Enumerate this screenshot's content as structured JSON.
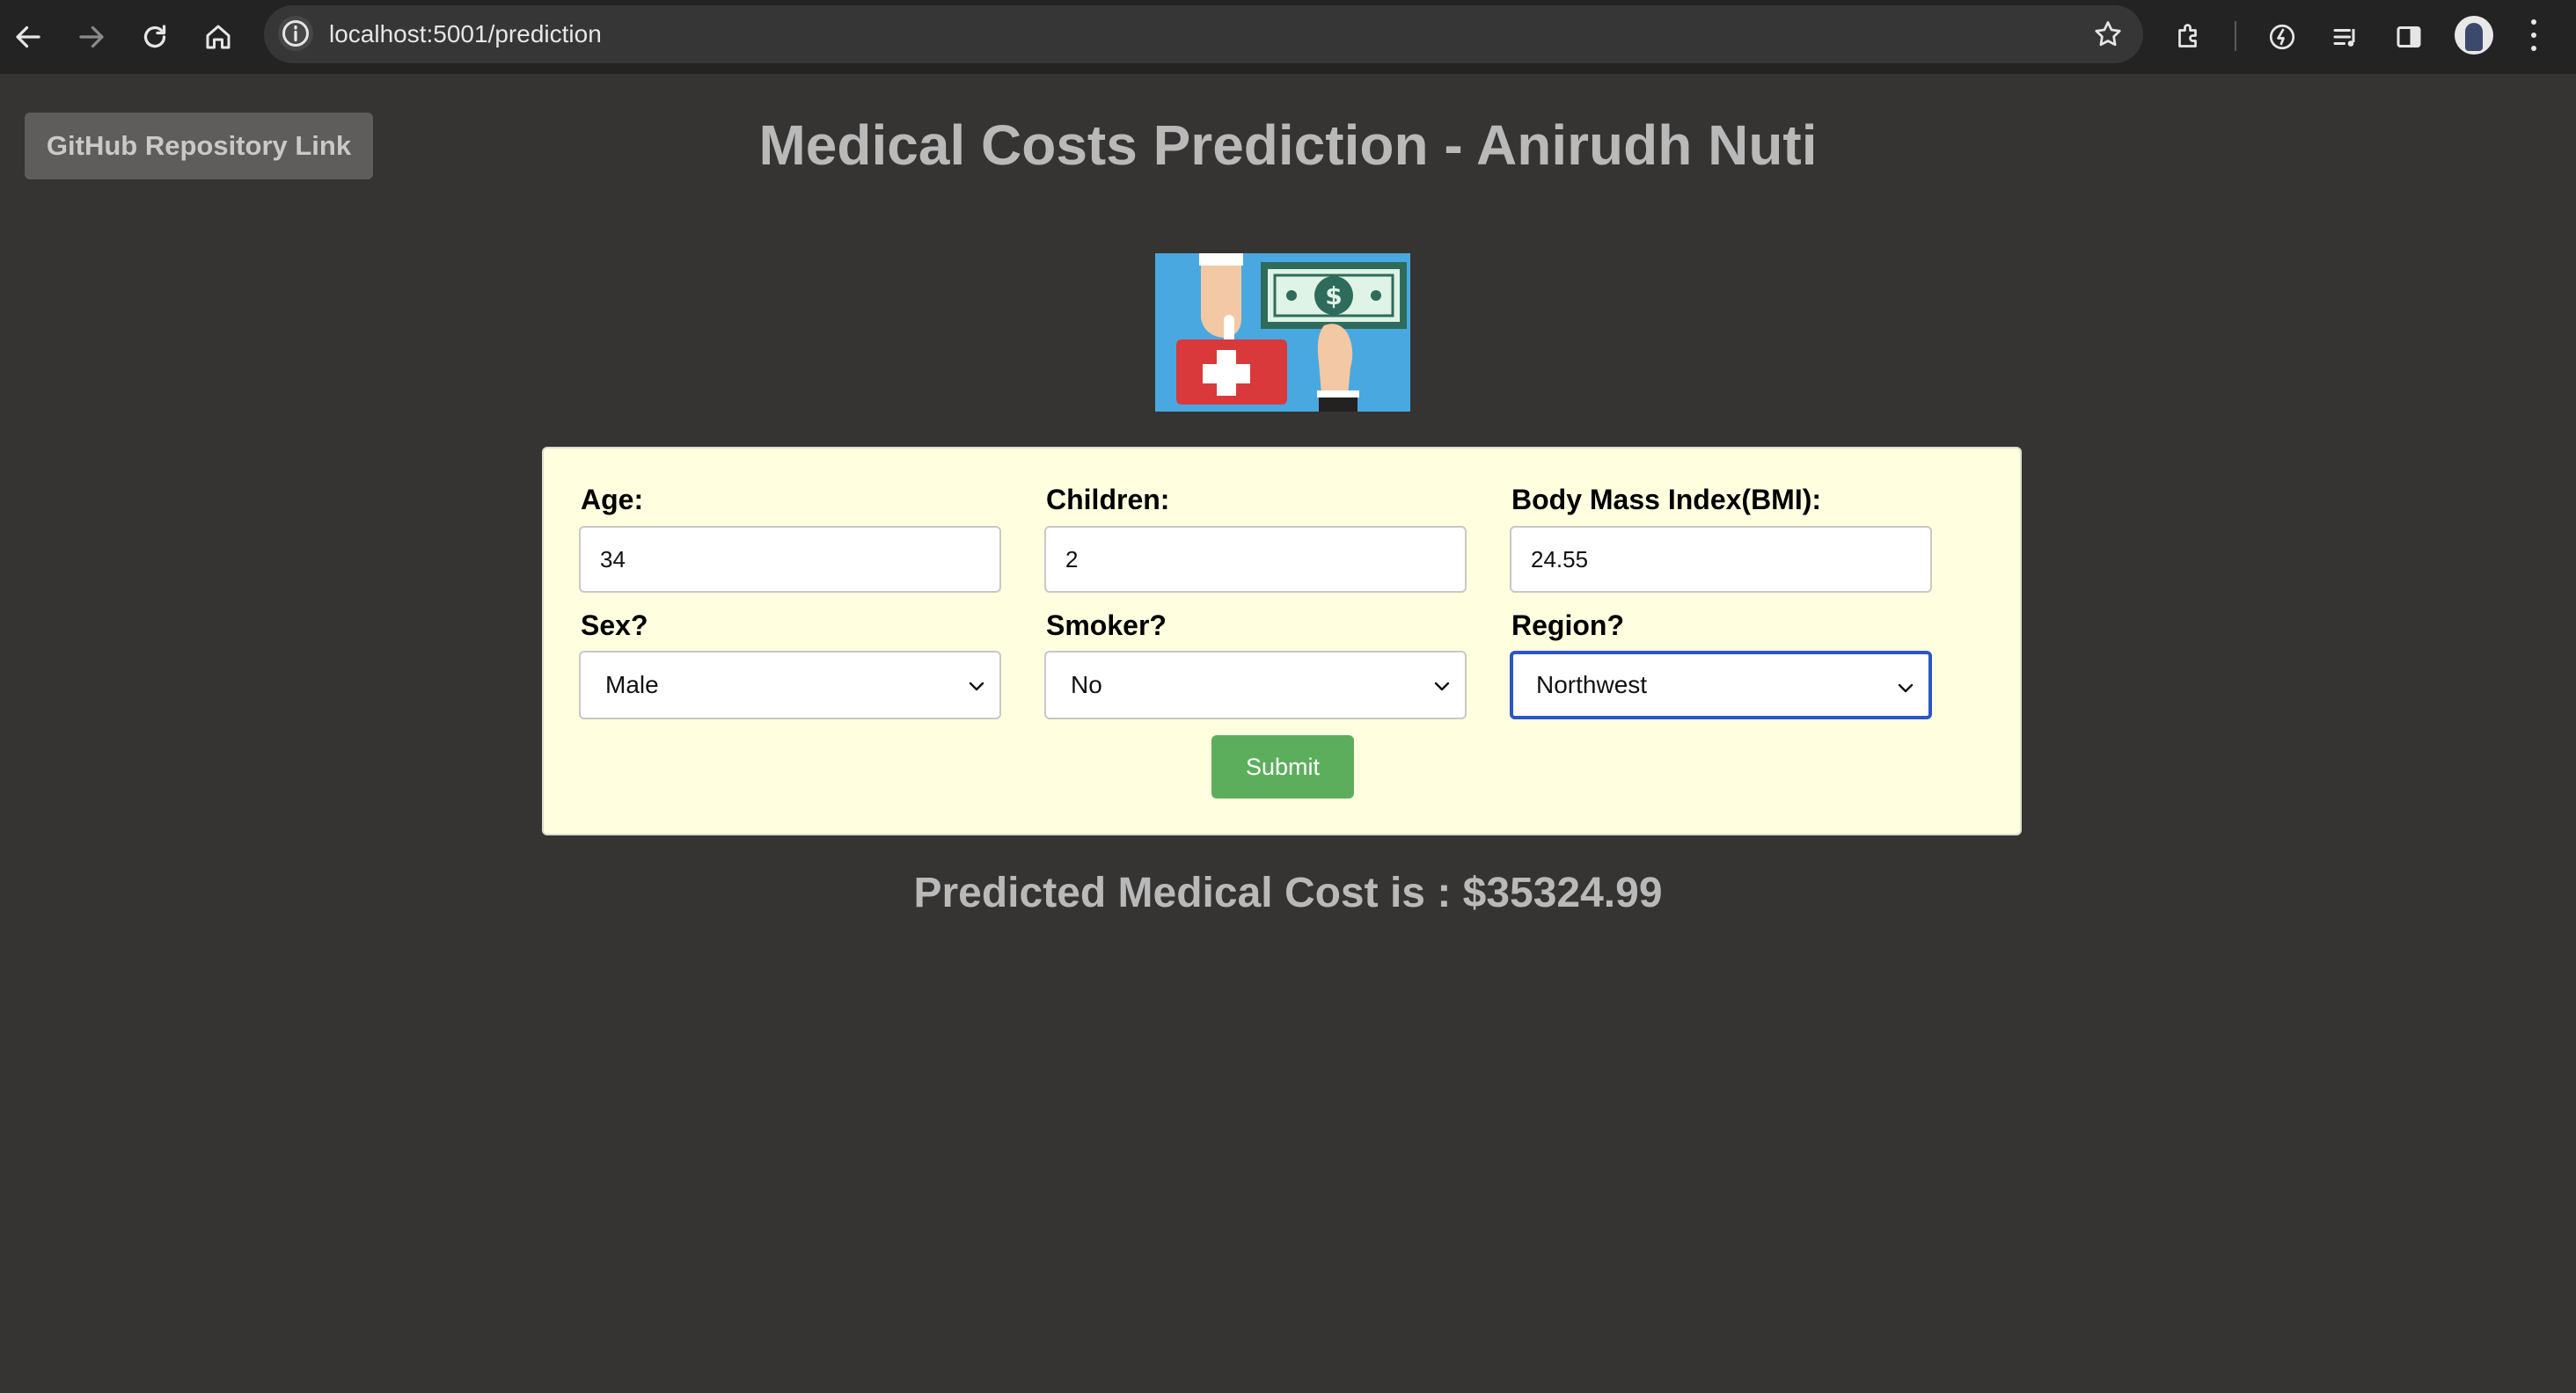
{
  "browser": {
    "url": "localhost:5001/prediction",
    "icons": [
      "back-arrow-icon",
      "forward-arrow-icon",
      "reload-icon",
      "home-icon",
      "site-info-icon",
      "bookmark-star-icon",
      "extensions-icon",
      "performance-icon",
      "media-controls-icon",
      "side-panel-icon",
      "profile-avatar",
      "menu-dots-icon"
    ]
  },
  "header": {
    "github_button": "GitHub Repository Link",
    "title": "Medical Costs Prediction - Anirudh Nuti"
  },
  "form": {
    "age": {
      "label": "Age:",
      "value": "34"
    },
    "children": {
      "label": "Children:",
      "value": "2"
    },
    "bmi": {
      "label": "Body Mass Index(BMI):",
      "value": "24.55"
    },
    "sex": {
      "label": "Sex?",
      "selected": "Male"
    },
    "smoker": {
      "label": "Smoker?",
      "selected": "No"
    },
    "region": {
      "label": "Region?",
      "selected": "Northwest"
    },
    "submit_label": "Submit"
  },
  "result": {
    "text": "Predicted Medical Cost is : $35324.99"
  },
  "colors": {
    "page_bg": "#353433",
    "card_bg": "#ffffe0",
    "submit_bg": "#5cae5c",
    "focus_border": "#2a56c6"
  }
}
